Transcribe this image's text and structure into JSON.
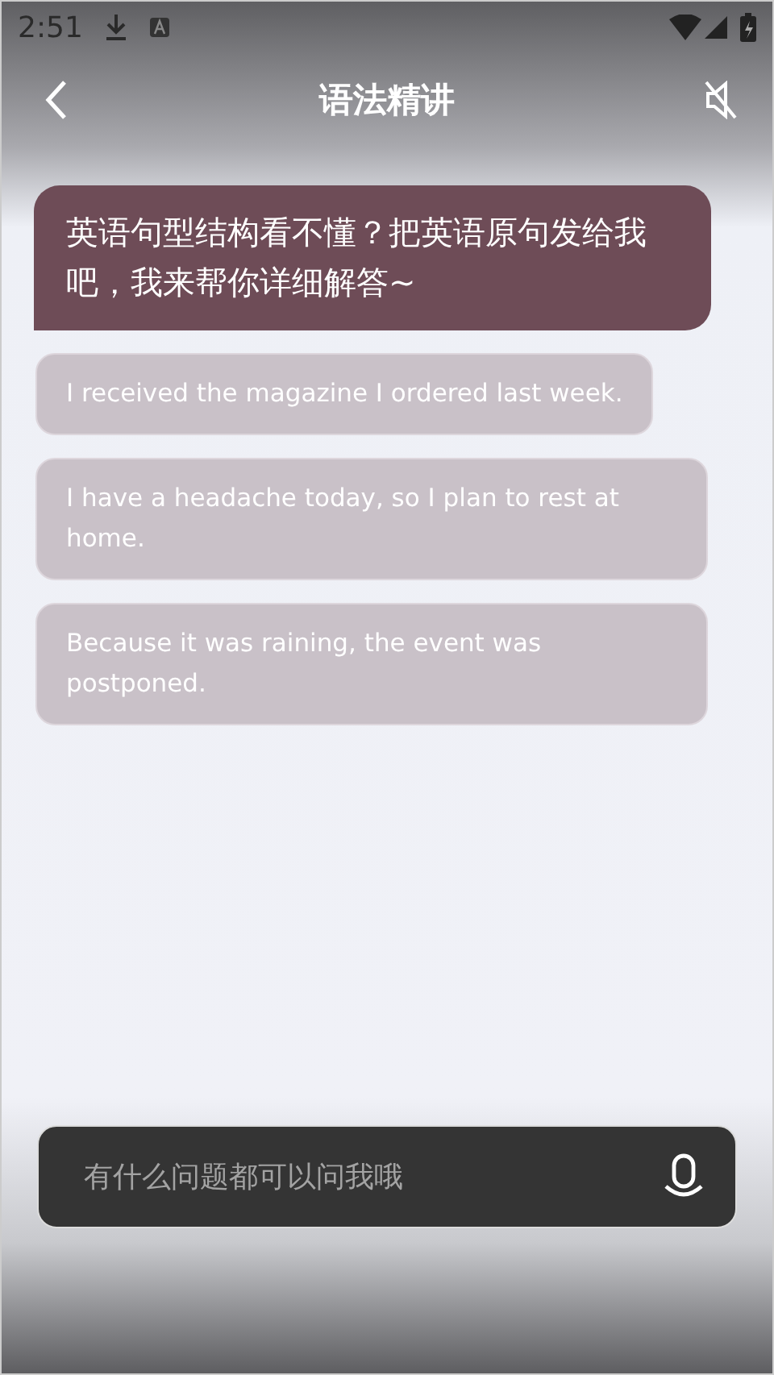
{
  "status_bar": {
    "time": "2:51"
  },
  "header": {
    "title": "语法精讲"
  },
  "greeting": {
    "text": "英语句型结构看不懂？把英语原句发给我吧，我来帮你详细解答~"
  },
  "suggestions": [
    {
      "text": "I received the magazine I ordered last week."
    },
    {
      "text": "I have a headache today, so I plan to rest at home."
    },
    {
      "text": "Because it was raining, the event was postponed."
    }
  ],
  "input": {
    "placeholder": "有什么问题都可以问我哦"
  }
}
